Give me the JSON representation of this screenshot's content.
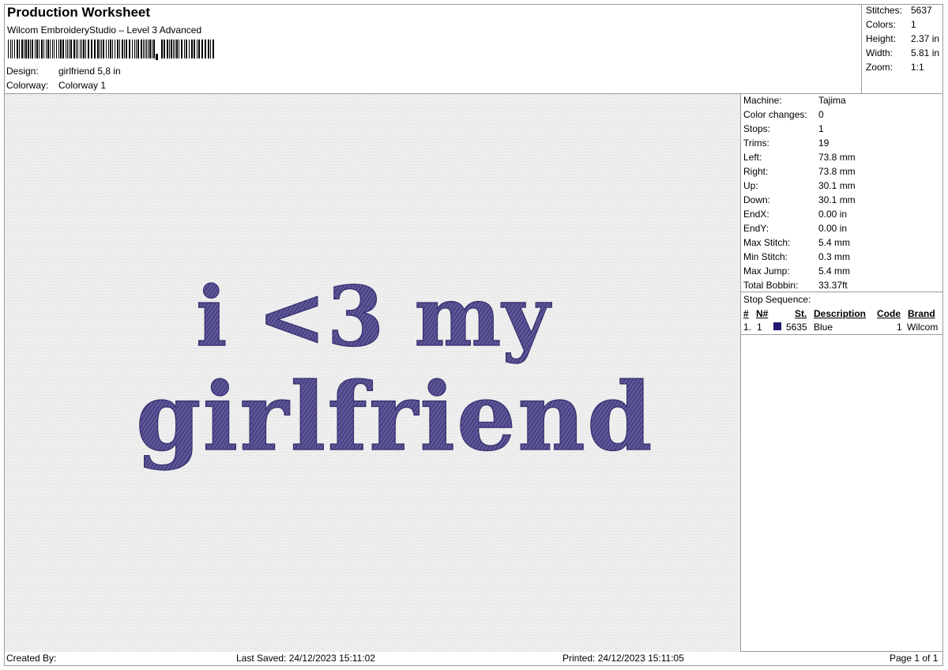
{
  "header": {
    "title": "Production Worksheet",
    "subtitle": "Wilcom EmbroideryStudio – Level 3 Advanced",
    "design_label": "Design:",
    "design_value": "girlfriend 5,8 in",
    "colorway_label": "Colorway:",
    "colorway_value": "Colorway 1"
  },
  "summary": [
    {
      "label": "Stitches:",
      "value": "5637"
    },
    {
      "label": "Colors:",
      "value": "1"
    },
    {
      "label": "Height:",
      "value": "2.37 in"
    },
    {
      "label": "Width:",
      "value": "5.81 in"
    },
    {
      "label": "Zoom:",
      "value": "1:1"
    }
  ],
  "machine_info": [
    {
      "label": "Machine:",
      "value": "Tajima"
    },
    {
      "label": "Color changes:",
      "value": "0"
    },
    {
      "label": "Stops:",
      "value": "1"
    },
    {
      "label": "Trims:",
      "value": "19"
    },
    {
      "label": "Left:",
      "value": "73.8 mm"
    },
    {
      "label": "Right:",
      "value": "73.8 mm"
    },
    {
      "label": "Up:",
      "value": "30.1 mm"
    },
    {
      "label": "Down:",
      "value": "30.1 mm"
    },
    {
      "label": "EndX:",
      "value": "0.00 in"
    },
    {
      "label": "EndY:",
      "value": "0.00 in"
    },
    {
      "label": "Max Stitch:",
      "value": "5.4 mm"
    },
    {
      "label": "Min Stitch:",
      "value": "0.3 mm"
    },
    {
      "label": "Max Jump:",
      "value": "5.4 mm"
    },
    {
      "label": "Total Bobbin:",
      "value": "33.37ft"
    }
  ],
  "stop_sequence": {
    "title": "Stop Sequence:",
    "columns": [
      "#",
      "N#",
      "St.",
      "Description",
      "Code",
      "Brand"
    ],
    "rows": [
      {
        "index": "1.",
        "n": "1",
        "stitches": "5635",
        "description": "Blue",
        "code": "1",
        "brand": "Wilcom",
        "color": "#1f1a6e"
      }
    ]
  },
  "design": {
    "line1": "i <3 my",
    "line2": "girlfriend",
    "thread_color": "#4a4388",
    "background_color": "#eaeaea"
  },
  "footer": {
    "created_by": "Created By:",
    "last_saved": "Last Saved: 24/12/2023 15:11:02",
    "printed": "Printed: 24/12/2023 15:11:05",
    "page": "Page 1 of 1"
  }
}
